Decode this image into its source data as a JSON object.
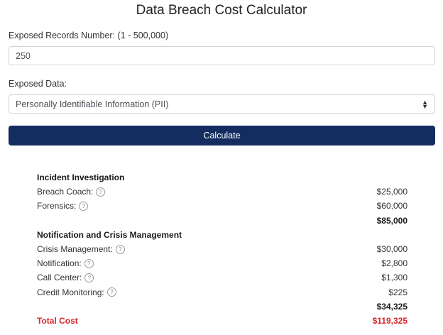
{
  "title": "Data Breach Cost Calculator",
  "form": {
    "records_label": "Exposed Records Number: (1 - 500,000)",
    "records_value": "250",
    "data_label": "Exposed Data:",
    "data_value": "Personally Identifiable Information (PII)",
    "calculate_label": "Calculate"
  },
  "results": {
    "incident": {
      "heading": "Incident Investigation",
      "items": [
        {
          "label": "Breach Coach:",
          "value": "$25,000"
        },
        {
          "label": "Forensics:",
          "value": "$60,000"
        }
      ],
      "subtotal": "$85,000"
    },
    "notification": {
      "heading": "Notification and Crisis Management",
      "items": [
        {
          "label": "Crisis Management:",
          "value": "$30,000"
        },
        {
          "label": "Notification:",
          "value": "$2,800"
        },
        {
          "label": "Call Center:",
          "value": "$1,300"
        },
        {
          "label": "Credit Monitoring:",
          "value": "$225"
        }
      ],
      "subtotal": "$34,325"
    },
    "total_label": "Total Cost",
    "total_value": "$119,325"
  },
  "help_glyph": "?",
  "colors": {
    "button": "#132d60",
    "total": "#d7262b"
  }
}
